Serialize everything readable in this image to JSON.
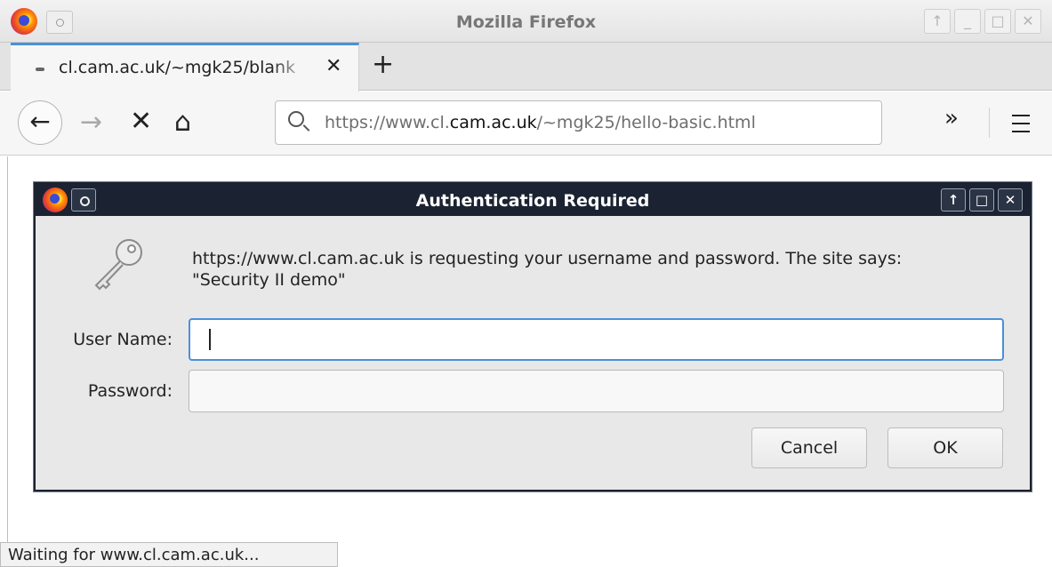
{
  "window": {
    "title": "Mozilla Firefox",
    "controls": [
      "↑",
      "_",
      "□",
      "✕"
    ]
  },
  "tabs": [
    {
      "title": "cl.cam.ac.uk/~mgk25/blank",
      "close": "✕",
      "loading": true
    }
  ],
  "newtab_label": "+",
  "nav": {
    "back": "←",
    "forward": "→",
    "stop": "✕",
    "home": "⌂",
    "url_prefix": "https://www.cl.",
    "url_host": "cam.ac.uk",
    "url_suffix": "/~mgk25/hello-basic.html",
    "overflow": "»",
    "icons": [
      "back-arrow-icon",
      "forward-arrow-icon",
      "stop-icon",
      "home-icon",
      "search-icon",
      "overflow-chevron-icon",
      "hamburger-menu-icon"
    ]
  },
  "dialog": {
    "title": "Authentication Required",
    "controls": [
      "↑",
      "□",
      "✕"
    ],
    "message_line1": "https://www.cl.cam.ac.uk is requesting your username and password. The site says:",
    "message_line2": "\"Security II demo\"",
    "username_label": "User Name:",
    "username_value": "",
    "password_label": "Password:",
    "password_value": "",
    "cancel_label": "Cancel",
    "ok_label": "OK",
    "icon": "key-icon"
  },
  "status": {
    "text": "Waiting for www.cl.cam.ac.uk..."
  },
  "colors": {
    "accent": "#4a90d9",
    "dialog_titlebar": "#1b2332"
  }
}
